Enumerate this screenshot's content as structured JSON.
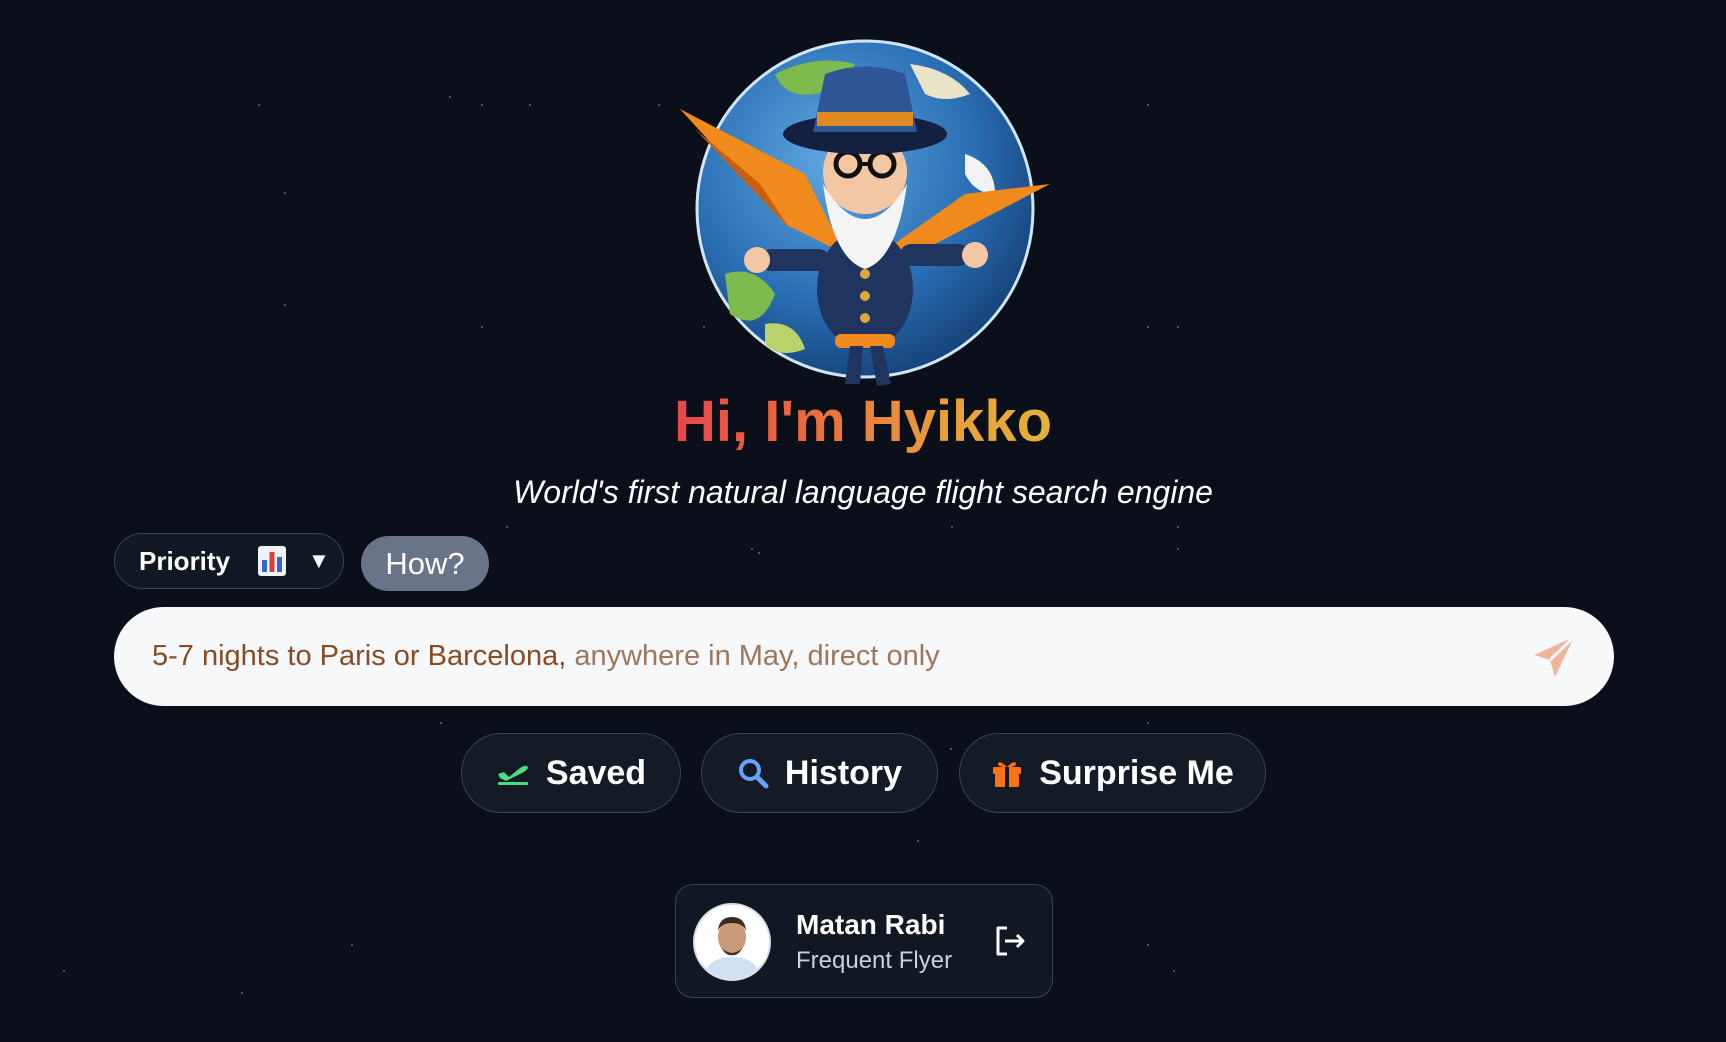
{
  "header": {
    "title": "Hi, I'm Hyikko",
    "subtitle": "World's first natural language flight search engine",
    "mascot_icon": "wizard-globe-mascot"
  },
  "controls": {
    "priority_label": "Priority",
    "priority_icon": "bar-chart-icon",
    "priority_caret": "▼",
    "how_label": "How?"
  },
  "search": {
    "typed_text": "5-7 nights to Paris or Barcelona,",
    "placeholder_rest": " anywhere in May, direct only",
    "send_icon": "paper-plane-icon",
    "text_color": "#8a4b22",
    "accent": "#f0b49a"
  },
  "actions": {
    "saved_label": "Saved",
    "saved_icon": "plane-departure-icon",
    "history_label": "History",
    "history_icon": "search-icon",
    "surprise_label": "Surprise Me",
    "surprise_icon": "gift-icon"
  },
  "user": {
    "name": "Matan Rabi",
    "role": "Frequent Flyer",
    "logout_icon": "logout-icon"
  },
  "colors": {
    "background": "#0a0f1a",
    "title_gradient_start": "#e8474b",
    "title_gradient_end": "#e2b23c",
    "how_button": "#6a7488",
    "saved_icon": "#4ade80",
    "history_icon": "#60a5fa",
    "surprise_icon": "#f97316"
  }
}
